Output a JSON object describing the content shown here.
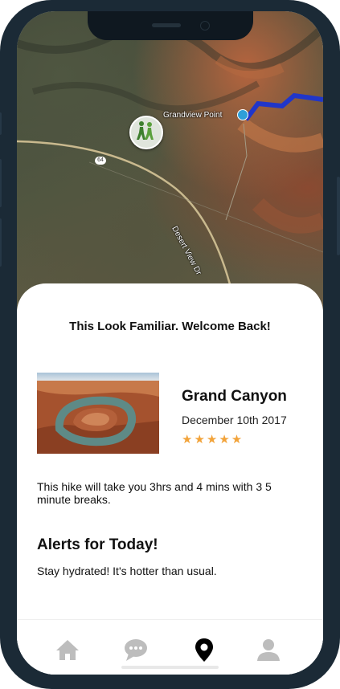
{
  "map": {
    "poi_label": "Grandview Point",
    "road_label": "Desert View Dr",
    "route_number": "64"
  },
  "sheet": {
    "welcome": "This Look Familiar. Welcome Back!",
    "hike": {
      "title": "Grand Canyon",
      "date": "December 10th 2017",
      "rating": 5,
      "stars": "★★★★★"
    },
    "description": "This hike will take you 3hrs and 4 mins with 3 5 minute breaks.",
    "alerts_title": "Alerts for Today!",
    "alerts_text": "Stay hydrated! It's hotter than usual."
  },
  "tabbar": {
    "active": "map",
    "items": [
      {
        "icon": "home-icon"
      },
      {
        "icon": "chat-icon"
      },
      {
        "icon": "map-pin-icon"
      },
      {
        "icon": "profile-icon"
      }
    ],
    "active_color": "#000000",
    "inactive_color": "#bdbdbd"
  },
  "colors": {
    "star": "#f2a33a",
    "device_frame": "#1b2a36"
  }
}
